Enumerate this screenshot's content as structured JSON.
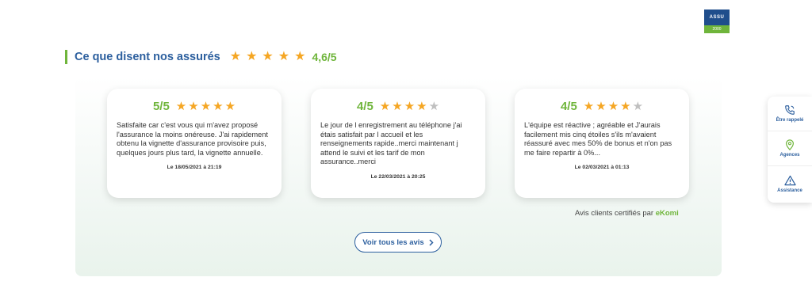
{
  "logo": {
    "top": "ASSU",
    "bottom": "2000"
  },
  "header": {
    "title": "Ce que disent nos assurés",
    "rating": "4,6/5"
  },
  "reviews": [
    {
      "score": "5/5",
      "stars": 5,
      "text": "Satisfaite car c'est vous qui m'avez proposé l'assurance la moins onéreuse. J'ai rapidement obtenu la vignette d'assurance provisoire puis, quelques jours plus tard, la vignette annuelle.",
      "date": "Le 18/05/2021 à 21:19"
    },
    {
      "score": "4/5",
      "stars": 4,
      "text": "Le jour de l enregistrement au téléphone j'ai étais satisfait par l accueil et les renseignements rapide..merci maintenant j attend le suivi et les tarif de mon assurance..merci",
      "date": "Le 22/03/2021 à 20:25"
    },
    {
      "score": "4/5",
      "stars": 4,
      "text": "L'équipe est réactive ; agréable et J'aurais facilement mis cinq étoiles s'ils m'avaient réassuré avec mes 50% de bonus et n'on pas me faire repartir à 0%...",
      "date": "Le 02/03/2021 à 01:13"
    }
  ],
  "certified": {
    "prefix": "Avis clients certifiés par",
    "brand": "eKomi"
  },
  "see_all": {
    "label": "Voir tous les avis",
    "icon": "chevron-right-icon"
  },
  "side_menu": [
    {
      "label": "Être rappelé",
      "icon": "phone-icon"
    },
    {
      "label": "Agences",
      "icon": "location-pin-icon"
    },
    {
      "label": "Assistance",
      "icon": "warning-icon"
    }
  ],
  "colors": {
    "primary": "#2c5f9e",
    "green": "#6fb53b",
    "star": "#f5a623",
    "star_empty": "#bfbfbf"
  }
}
